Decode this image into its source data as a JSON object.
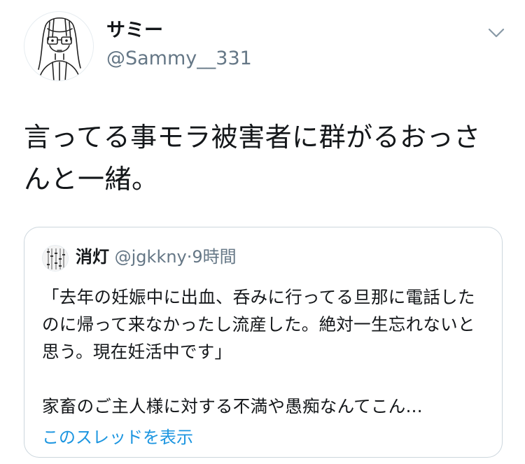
{
  "author": {
    "name": "サミー",
    "handle": "@Sammy__331"
  },
  "tweet": {
    "text": "言ってる事モラ被害者に群がるおっさんと一緒。"
  },
  "quoted": {
    "name": "消灯",
    "handle": "@jgkkny",
    "separator": "·",
    "time": "9時間",
    "paragraph1": "「去年の妊娠中に出血、呑みに行ってる旦那に電話したのに帰って来なかったし流産した。絶対一生忘れないと思う。現在妊活中です」",
    "paragraph2": "家畜のご主人様に対する不満や愚痴なんてこん...",
    "show_thread": "このスレッドを表示"
  },
  "icons": {
    "menu": "chevron-down-icon"
  },
  "colors": {
    "link": "#1b95e0",
    "secondary_text": "#657786",
    "border": "#ccd6dd"
  }
}
